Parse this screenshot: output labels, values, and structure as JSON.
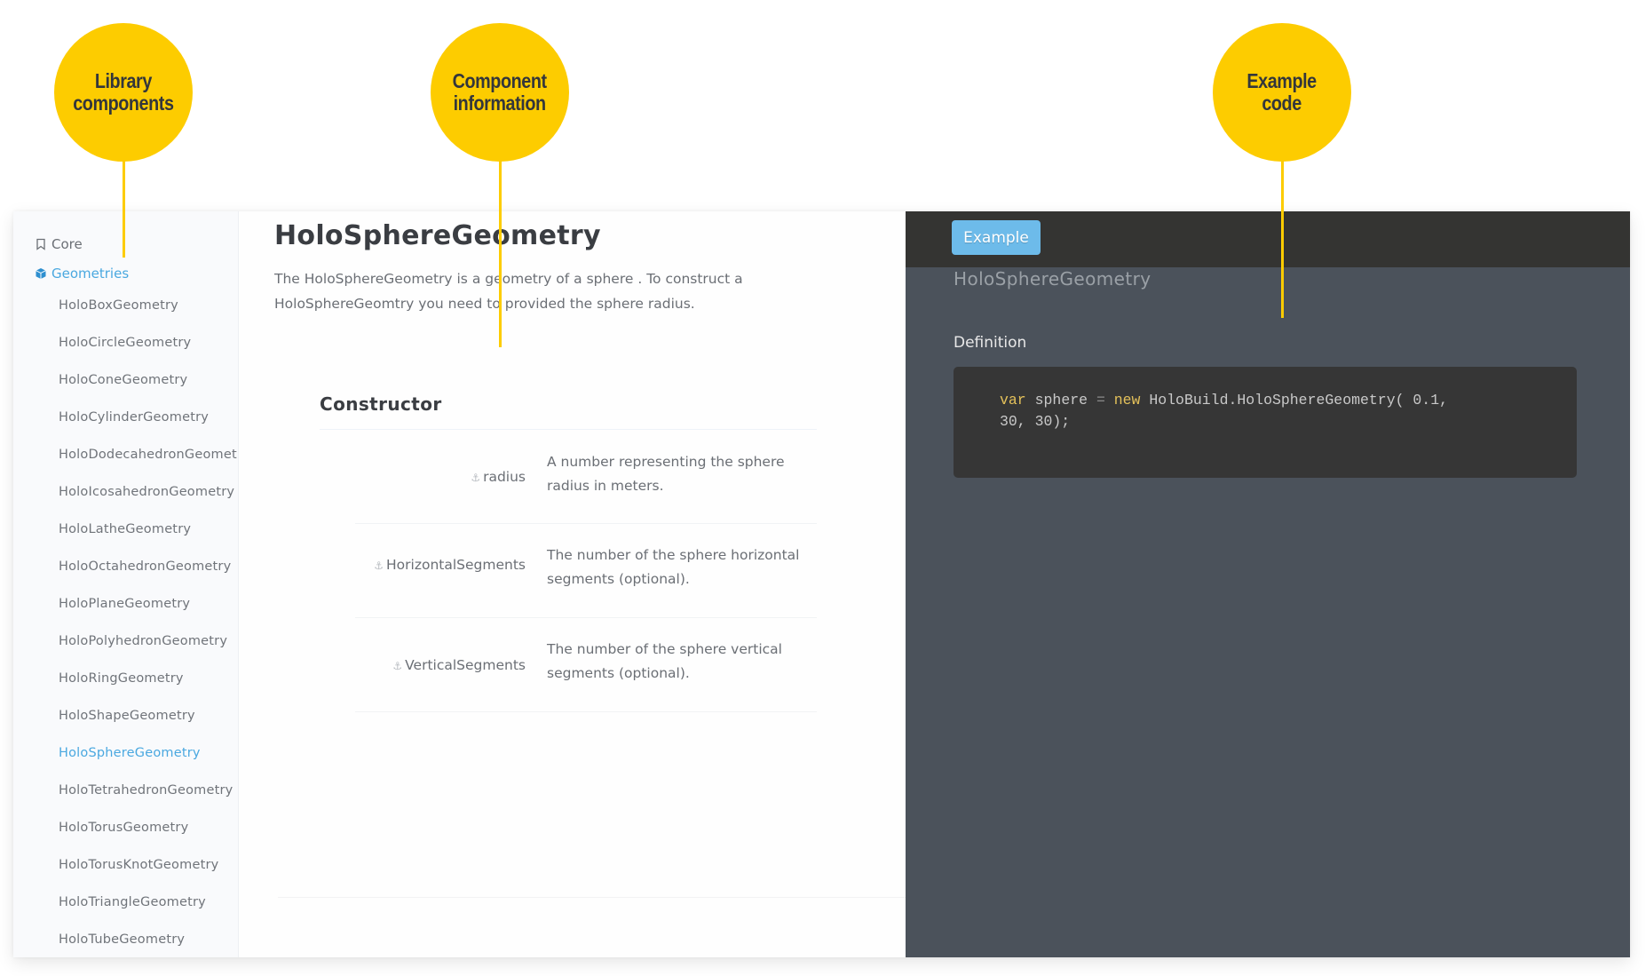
{
  "callouts": [
    {
      "label": "Library\ncomponents"
    },
    {
      "label": "Component\ninformation"
    },
    {
      "label": "Example\ncode"
    }
  ],
  "sidebar": {
    "sections": [
      {
        "label": "Core",
        "icon": "bookmark-icon",
        "active": false
      },
      {
        "label": "Geometries",
        "icon": "cube-icon",
        "active": true
      }
    ],
    "items": [
      {
        "label": "HoloBoxGeometry"
      },
      {
        "label": "HoloCircleGeometry"
      },
      {
        "label": "HoloConeGeometry"
      },
      {
        "label": "HoloCylinderGeometry"
      },
      {
        "label": "HoloDodecahedronGeometry"
      },
      {
        "label": "HoloIcosahedronGeometry"
      },
      {
        "label": "HoloLatheGeometry"
      },
      {
        "label": "HoloOctahedronGeometry"
      },
      {
        "label": "HoloPlaneGeometry"
      },
      {
        "label": "HoloPolyhedronGeometry"
      },
      {
        "label": "HoloRingGeometry"
      },
      {
        "label": "HoloShapeGeometry"
      },
      {
        "label": "HoloSphereGeometry",
        "active": true
      },
      {
        "label": "HoloTetrahedronGeometry"
      },
      {
        "label": "HoloTorusGeometry"
      },
      {
        "label": "HoloTorusKnotGeometry"
      },
      {
        "label": "HoloTriangleGeometry"
      },
      {
        "label": "HoloTubeGeometry"
      }
    ]
  },
  "content": {
    "title": "HoloSphereGeometry",
    "description": "The HoloSphereGeometry is a geometry of a sphere . To construct a HoloSphereGeomtry you need to provided the sphere radius.",
    "section_title": "Constructor",
    "params": [
      {
        "name": "radius",
        "description": "A number representing the sphere radius in meters."
      },
      {
        "name": "HorizontalSegments",
        "description": "The number of the sphere horizontal segments (optional)."
      },
      {
        "name": "VerticalSegments",
        "description": "The number of the sphere vertical segments (optional)."
      }
    ]
  },
  "example_panel": {
    "tab_label": "Example",
    "title": "HoloSphereGeometry",
    "subtitle": "Definition",
    "code": {
      "kw_var": "var",
      "ident": " sphere ",
      "op": "=",
      "kw_new": " new",
      "rest": " HoloBuild.HoloSphereGeometry( 0.1,\n30, 30);"
    }
  },
  "colors": {
    "callout": "#fdcc00",
    "accent": "#4aa8e0",
    "button": "#6dbbea",
    "dark_header": "#343432",
    "dark_panel": "#4b525b",
    "code_bg": "#363636",
    "keyword": "#e3c05a"
  }
}
